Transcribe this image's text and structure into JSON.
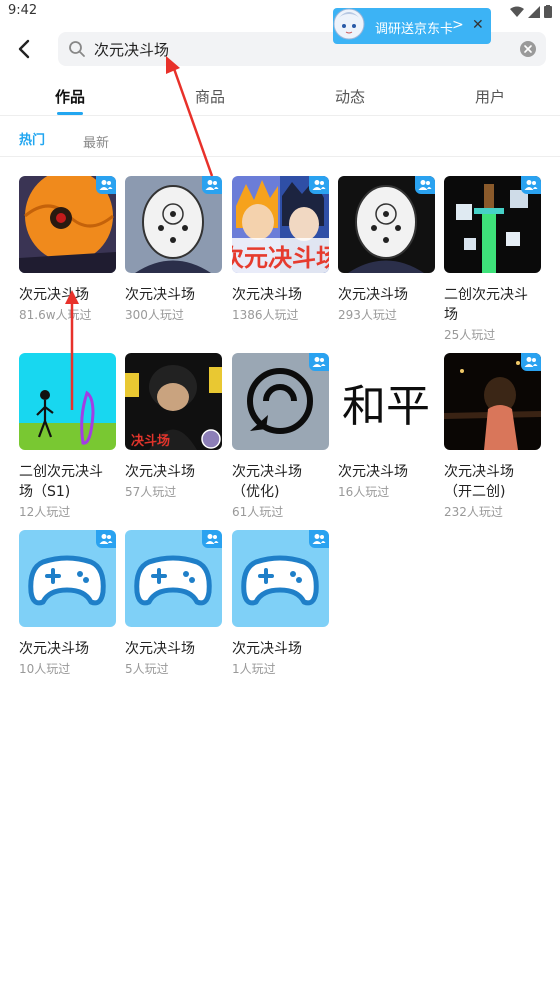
{
  "status": {
    "time": "9:42"
  },
  "promo": {
    "text": "调研送京东卡",
    "arrow": ">",
    "close": "✕"
  },
  "search": {
    "value": "次元决斗场"
  },
  "tabs": [
    {
      "label": "作品",
      "active": true
    },
    {
      "label": "商品"
    },
    {
      "label": "动态"
    },
    {
      "label": "用户"
    }
  ],
  "subtabs": [
    {
      "label": "热门",
      "active": true
    },
    {
      "label": "最新"
    }
  ],
  "cards": [
    {
      "title": "次元决斗场",
      "plays": "81.6w人玩过",
      "thumb": "orange-mask",
      "badge": true
    },
    {
      "title": "次元决斗场",
      "plays": "300人玩过",
      "thumb": "gray-mask",
      "badge": true
    },
    {
      "title": "次元决斗场",
      "plays": "1386人玩过",
      "thumb": "anime-duo",
      "badge": true,
      "thumb_text": "次元决斗场"
    },
    {
      "title": "次元决斗场",
      "plays": "293人玩过",
      "thumb": "gray-mask-dark",
      "badge": true
    },
    {
      "title": "二创次元决斗场",
      "plays": "25人玩过",
      "thumb": "minecraft-sword",
      "badge": true
    },
    {
      "title": "二创次元决斗场（S1)",
      "plays": "12人玩过",
      "thumb": "stick-figure",
      "badge": false
    },
    {
      "title": "次元决斗场",
      "plays": "57人玩过",
      "thumb": "dark-character",
      "badge": false,
      "thumb_text": "决斗场"
    },
    {
      "title": "次元决斗场（优化)",
      "plays": "61人玩过",
      "thumb": "leaf-symbol",
      "badge": true
    },
    {
      "title": "次元决斗场",
      "plays": "16人玩过",
      "thumb": "calligraphy",
      "badge": false,
      "thumb_text": "和平"
    },
    {
      "title": "次元决斗场（开二创)",
      "plays": "232人玩过",
      "thumb": "night-girl",
      "badge": true
    },
    {
      "title": "次元决斗场",
      "plays": "10人玩过",
      "thumb": "gamepad",
      "badge": true
    },
    {
      "title": "次元决斗场",
      "plays": "5人玩过",
      "thumb": "gamepad",
      "badge": true
    },
    {
      "title": "次元决斗场",
      "plays": "1人玩过",
      "thumb": "gamepad",
      "badge": true
    }
  ],
  "colors": {
    "accent": "#22a6f0",
    "badge": "#2aa2f0",
    "annotation": "#e8312a",
    "gamepad_bg": "#7fd0f7"
  }
}
